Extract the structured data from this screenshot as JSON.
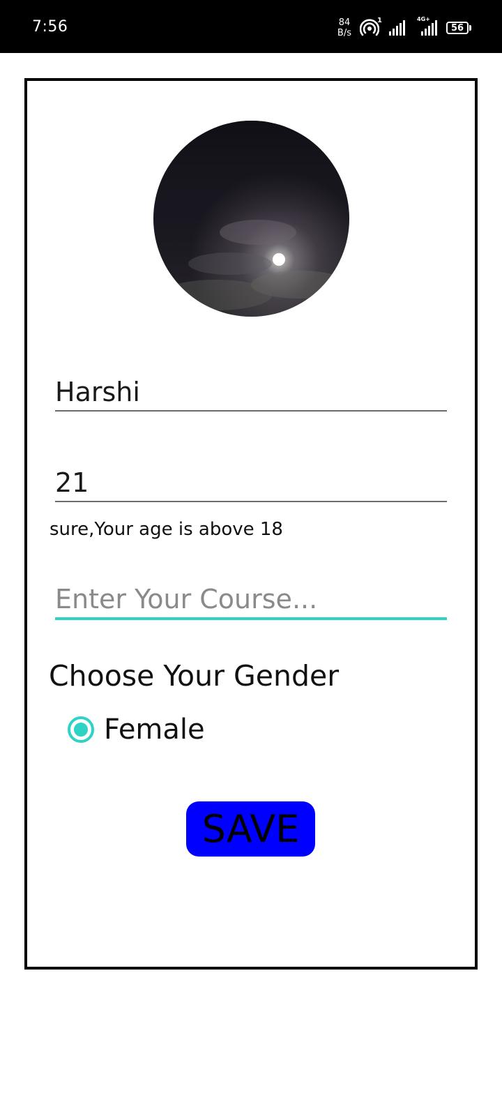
{
  "status_bar": {
    "time": "7:56",
    "net_speed_value": "84",
    "net_speed_unit": "B/s",
    "hotspot_count": "1",
    "network_type": "4G+",
    "battery_level": "56"
  },
  "form": {
    "name_value": "Harshi",
    "age_value": "21",
    "age_message": "sure,Your age is above 18",
    "course_placeholder": "Enter Your Course...",
    "gender_heading": "Choose Your Gender",
    "gender_option": "Female",
    "save_label": "SAVE"
  },
  "colors": {
    "accent": "#2fd3c6",
    "save_button": "#0000ff"
  }
}
